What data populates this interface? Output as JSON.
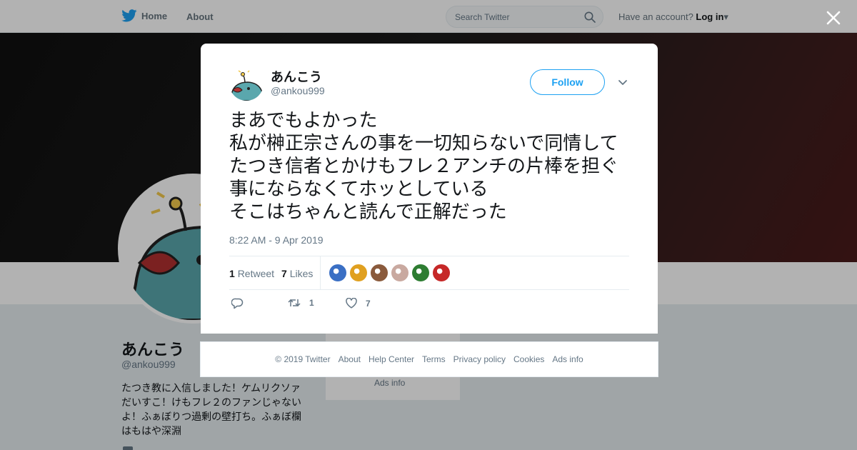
{
  "nav": {
    "home_label": "Home",
    "about_label": "About",
    "search_placeholder": "Search Twitter",
    "account_prompt": "Have an account?",
    "login_label": "Log in"
  },
  "profile": {
    "name": "あんこう",
    "handle": "@ankou999",
    "bio": "たつき教に入信しました！ケムリクソァだいすこ！けもフレ２のファンじゃないよ！ふぁぼりつ過剰の壁打ち。ふぁぼ欄はもはや深淵",
    "side_ads": "Ads info"
  },
  "tweet": {
    "author_name": "あんこう",
    "author_handle": "@ankou999",
    "follow_label": "Follow",
    "text": "まあでもよかった\n私が榊正宗さんの事を一切知らないで同情してたつき信者とかけもフレ２アンチの片棒を担ぐ事にならなくてホッとしている\nそこはちゃんと読んで正解だった",
    "timestamp": "8:22 AM - 9 Apr 2019",
    "retweets_count": "1",
    "retweets_label": "Retweet",
    "likes_count": "7",
    "likes_label": "Likes",
    "action_retweet_count": "1",
    "action_like_count": "7"
  },
  "likers": [
    {
      "icon": "liker-avatar-1",
      "color": "#3a6fc4"
    },
    {
      "icon": "liker-avatar-2",
      "color": "#e0a020"
    },
    {
      "icon": "liker-avatar-3",
      "color": "#8a5a3c"
    },
    {
      "icon": "liker-avatar-4",
      "color": "#c9a9a0"
    },
    {
      "icon": "liker-avatar-5",
      "color": "#2e7d32"
    },
    {
      "icon": "liker-avatar-6",
      "color": "#c62828"
    }
  ],
  "footer": {
    "copyright": "© 2019 Twitter",
    "about": "About",
    "help": "Help Center",
    "terms": "Terms",
    "privacy": "Privacy policy",
    "cookies": "Cookies",
    "ads": "Ads info"
  },
  "colors": {
    "accent": "#1da1f2",
    "muted": "#657786",
    "avatar_fish": "#5aa7ad"
  }
}
